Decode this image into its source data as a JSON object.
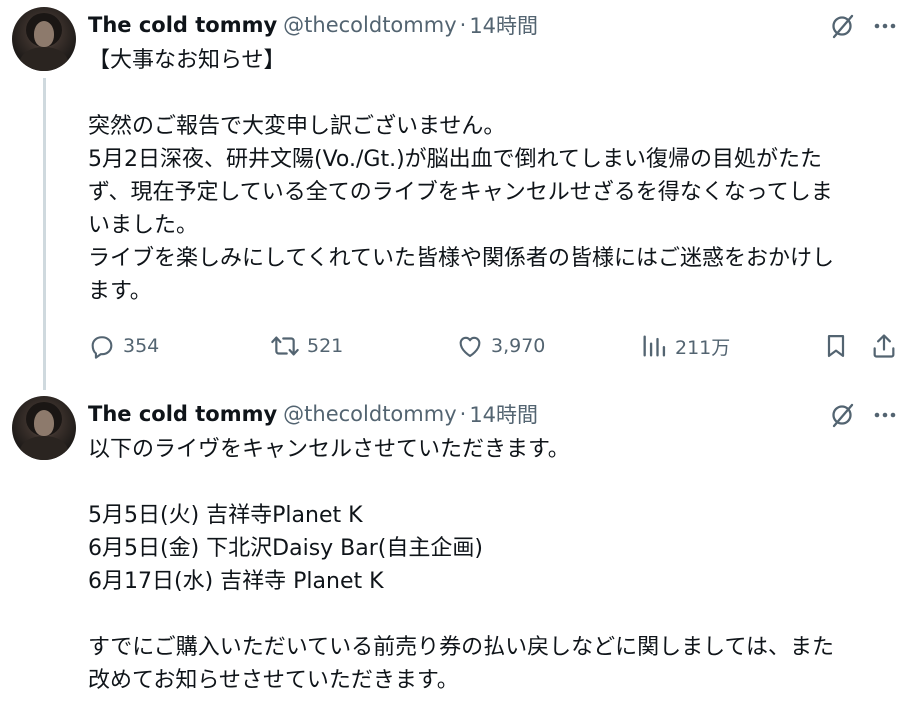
{
  "tweets": [
    {
      "author_name": "The cold tommy",
      "handle": "@thecoldtommy",
      "separator": "·",
      "time": "14時間",
      "lines": [
        "【大事なお知らせ】",
        "",
        "突然のご報告で大変申し訳ございません。",
        "5月2日深夜、研井文陽(Vo./Gt.)が脳出血で倒れてしまい復帰の目処がたた",
        "ず、現在予定している全てのライブをキャンセルせざるを得なくなってしま",
        "いました。",
        "ライブを楽しみにしてくれていた皆様や関係者の皆様にはご迷惑をおかけし",
        "ます。"
      ],
      "replies": "354",
      "reposts": "521",
      "likes": "3,970",
      "views": "211万"
    },
    {
      "author_name": "The cold tommy",
      "handle": "@thecoldtommy",
      "separator": "·",
      "time": "14時間",
      "lines": [
        "以下のライヴをキャンセルさせていただきます。",
        "",
        "5月5日(火) 吉祥寺Planet K",
        "6月5日(金) 下北沢Daisy Bar(自主企画)",
        "6月17日(水) 吉祥寺 Planet K",
        "",
        "すでにご購入いただいている前売り券の払い戻しなどに関しましては、また",
        "改めてお知らせさせていただきます。"
      ]
    }
  ],
  "icons": {
    "grok": "grok-icon",
    "more": "more-icon",
    "reply": "reply-icon",
    "repost": "repost-icon",
    "like": "heart-icon",
    "views": "views-icon",
    "bookmark": "bookmark-icon",
    "share": "share-icon"
  },
  "colors": {
    "text": "#0f1419",
    "secondary": "#536471",
    "thread_line": "#cfd9de"
  }
}
